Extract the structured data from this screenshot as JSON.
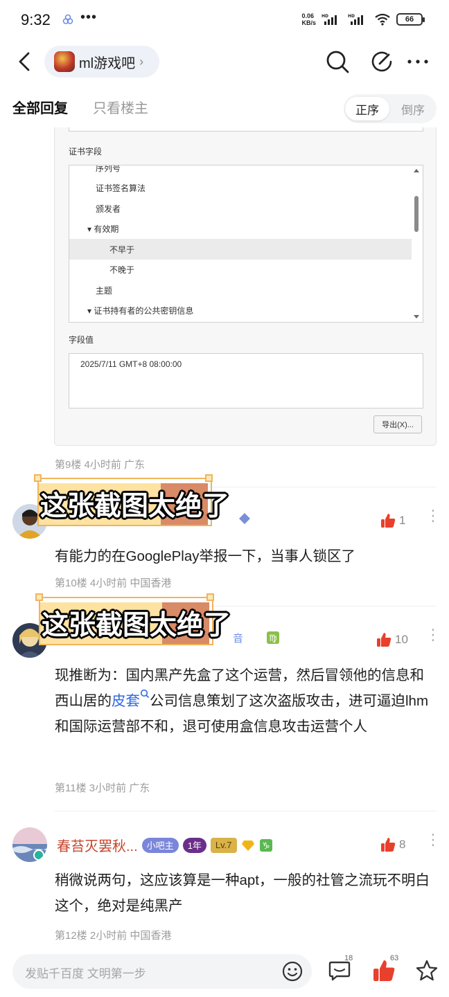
{
  "status_bar": {
    "time": "9:32",
    "dots": "•••",
    "net_speed_value": "0.06",
    "net_speed_unit": "KB/s",
    "battery": "66"
  },
  "nav": {
    "forum_name": "ml游戏吧",
    "chevron": "›"
  },
  "tabs": {
    "all_replies": "全部回复",
    "op_only": "只看楼主",
    "order_asc": "正序",
    "order_desc": "倒序"
  },
  "certificate": {
    "fields_label": "证书字段",
    "items": [
      {
        "label": "序列号",
        "indent": 1
      },
      {
        "label": "证书签名算法",
        "indent": 1
      },
      {
        "label": "颁发者",
        "indent": 1
      },
      {
        "label": "▾ 有效期",
        "indent": 0
      },
      {
        "label": "不早于",
        "indent": 2,
        "selected": true
      },
      {
        "label": "不晚于",
        "indent": 2
      },
      {
        "label": "主题",
        "indent": 1
      },
      {
        "label": "▾ 证书持有者的公共密钥信息",
        "indent": 0
      }
    ],
    "value_label": "字段值",
    "value_text": "2025/7/11 GMT+8 08:00:00",
    "export_button": "导出(X)..."
  },
  "floor9_meta": "第9楼   4小时前   广东",
  "sticker_text": "这张截图太绝了",
  "comments": [
    {
      "like_count": "1",
      "text": "有能力的在GooglePlay举报一下，当事人锁区了",
      "meta": "第10楼   4小时前   中国香港"
    },
    {
      "like_count": "10",
      "partial_name": "音",
      "text_before": "现推断为：国内黑产先盒了这个运营，然后冒领他的信息和西山居的",
      "link": "皮套",
      "text_after": "公司信息策划了这次盗版攻击，进可逼迫lhm和国际运营部不和，退可使用盒信息攻击运营个人",
      "meta": "第11楼   3小时前   广东"
    },
    {
      "username": "春苔灭罢秋...",
      "badge_role": "小吧主",
      "badge_year": "1年",
      "badge_level": "Lv.7",
      "like_count": "8",
      "text": "稍微说两句，这应该算是一种apt，一般的社管之流玩不明白这个，绝对是纯黑产",
      "meta": "第12楼   2小时前   中国香港"
    }
  ],
  "bottom_bar": {
    "placeholder": "发贴千百度 文明第一步",
    "comment_count": "18",
    "like_count": "63"
  },
  "colors": {
    "username": "#c8452c",
    "like_icon": "#e8402d",
    "link": "#2f6ae0",
    "sticker_fill": "#fde2a1",
    "sticker_accent": "#d98a66"
  }
}
